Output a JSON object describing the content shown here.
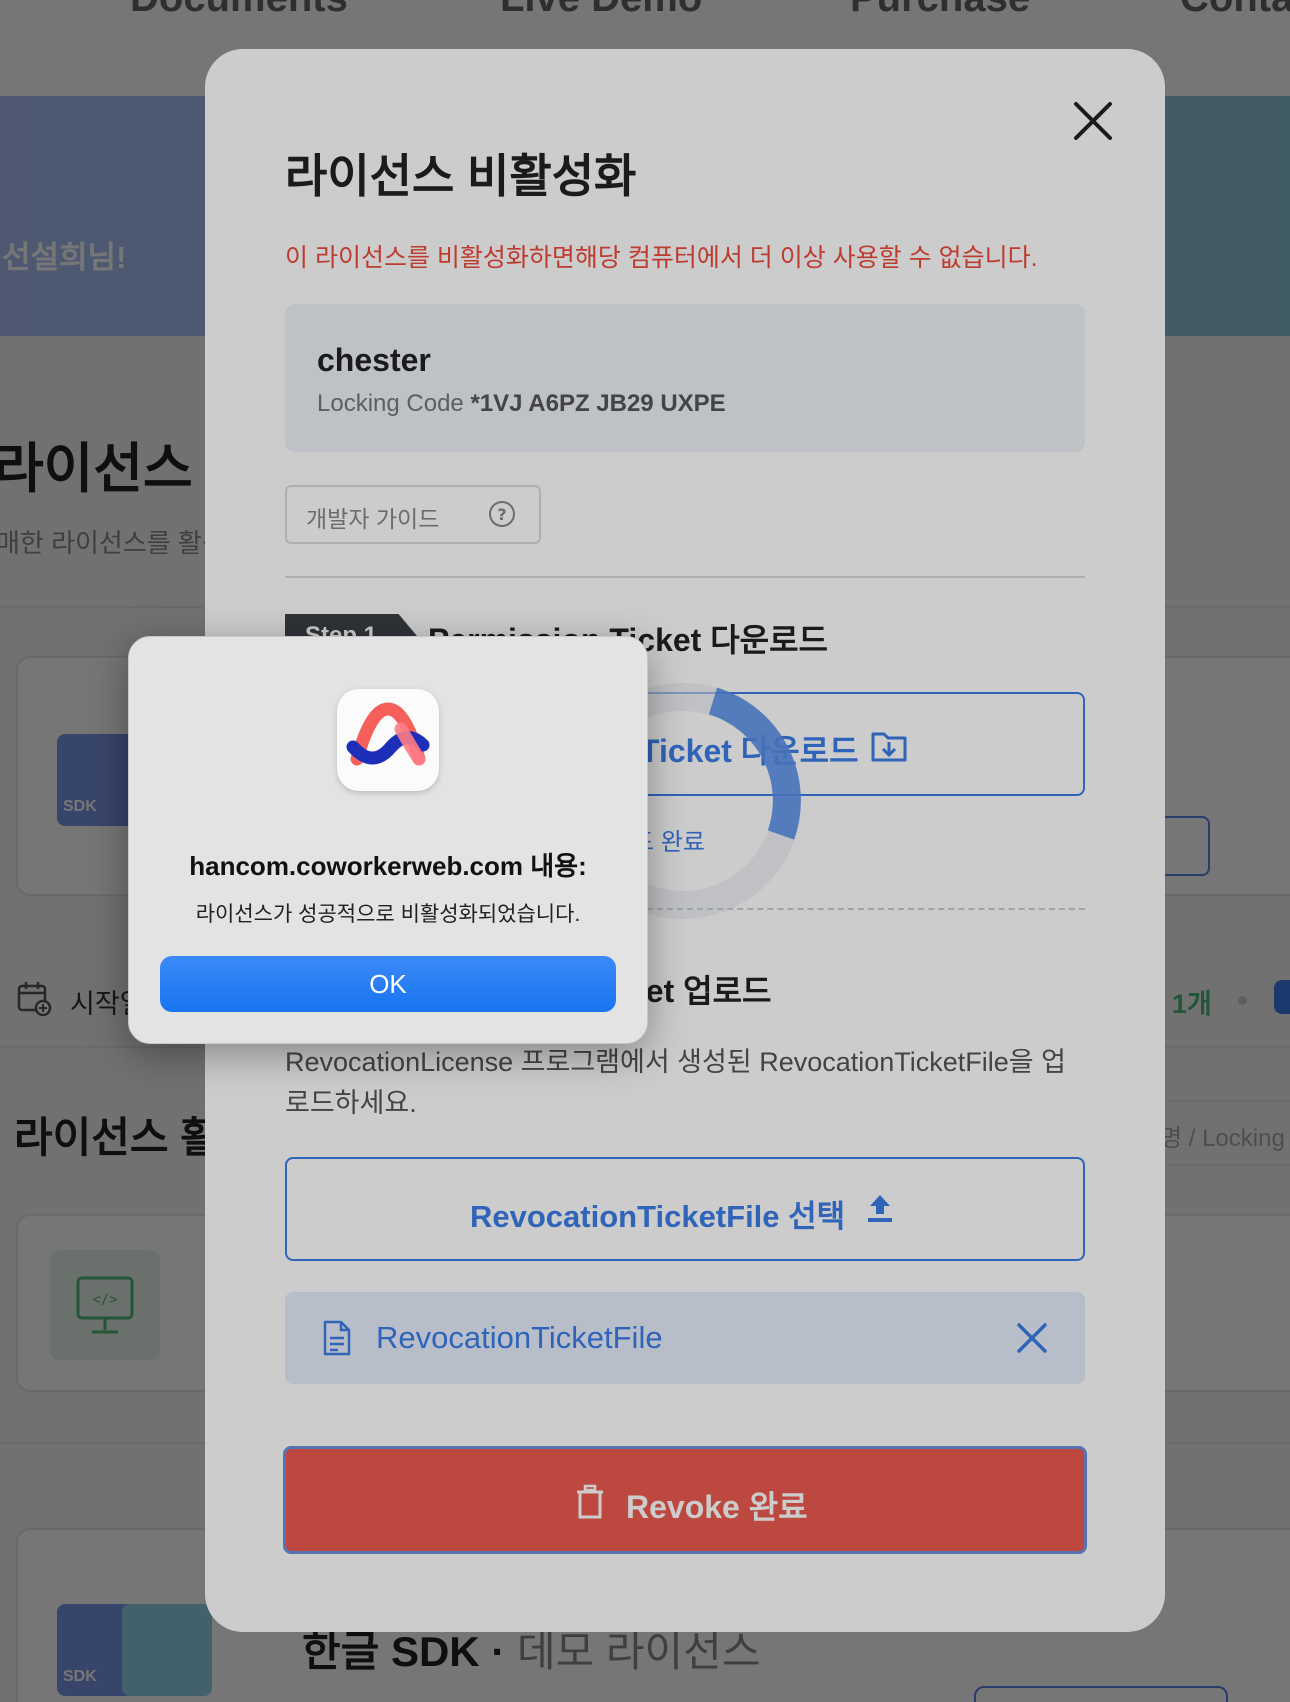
{
  "background": {
    "nav": [
      "Documents",
      "Live Demo",
      "Purchase",
      "Conta"
    ],
    "hero_greeting": "선설희님!",
    "page_title": "라이선스 관",
    "page_subtitle": "매한 라이선스를 활성",
    "start_label": "시작일",
    "count_text": "1개",
    "activation_title": "라이선스 활성",
    "search_placeholder": "명 / Locking",
    "sdk_label": "SDK",
    "bottom_title": "한글 SDK",
    "bottom_subtitle": "데모 라이선스"
  },
  "modal": {
    "title": "라이선스 비활성화",
    "warning": "이 라이선스를 비활성화하면해당 컴퓨터에서 더 이상 사용할 수 없습니다.",
    "user_name": "chester",
    "locking_code_label": "Locking Code",
    "locking_code_value": "*1VJ A6PZ JB29 UXPE",
    "guide_label": "개발자 가이드",
    "step1_badge": "Step 1",
    "step1_title": "Permission Ticket 다운로드",
    "download_label": "Ticket 다운로드",
    "download_status": "드 완료",
    "step2_title": "ket 업로드",
    "step2_desc": "RevocationLicense 프로그램에서 생성된 RevocationTicketFile을 업로드하세요.",
    "select_label": "RevocationTicketFile 선택",
    "file_name": "RevocationTicketFile",
    "revoke_label": "Revoke 완료"
  },
  "alert": {
    "title": "hancom.coworkerweb.com 내용:",
    "message": "라이선스가 성공적으로 비활성화되었습니다.",
    "ok_label": "OK"
  },
  "colors": {
    "accent": "#3b7de8",
    "danger": "#ec5b4f",
    "warning_text": "#ee4b3b"
  }
}
